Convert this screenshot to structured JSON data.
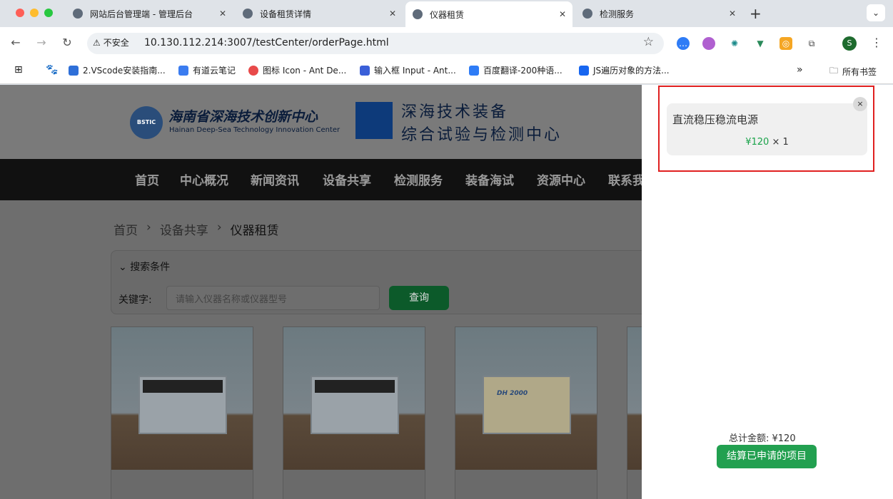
{
  "browser": {
    "tabs": [
      {
        "title": "网站后台管理端 - 管理后台",
        "active": false
      },
      {
        "title": "设备租赁详情",
        "active": false
      },
      {
        "title": "仪器租赁",
        "active": true
      },
      {
        "title": "检测服务",
        "active": false
      }
    ],
    "new_tab": "+",
    "security_label": "不安全",
    "url": "10.130.112.214:3007/testCenter/orderPage.html",
    "profile_initial": "S",
    "bookmarks": [
      "2.VScode安装指南...",
      "有道云笔记",
      "图标 Icon - Ant De...",
      "输入框 Input - Ant...",
      "百度翻译-200种语...",
      "JS遍历对象的方法..."
    ],
    "bookmarks_more": "»",
    "all_bookmarks": "所有书签"
  },
  "site": {
    "logo_text": "BSTIC",
    "org_name_cn": "海南省深海技术创新中心",
    "org_name_en": "Hainan Deep-Sea Technology Innovation Center",
    "center_line1": "深海技术装备",
    "center_line2": "综合试验与检测中心",
    "nav": [
      "首页",
      "中心概况",
      "新闻资讯",
      "设备共享",
      "检测服务",
      "装备海试",
      "资源中心",
      "联系我"
    ],
    "breadcrumb": [
      "首页",
      "设备共享",
      "仪器租赁"
    ],
    "breadcrumb_sep": "›",
    "search_header": "搜索条件",
    "keyword_label": "关键字:",
    "keyword_placeholder": "请输入仪器名称或仪器型号",
    "query_button": "查询",
    "card3_model": "DH 2000"
  },
  "cart": {
    "close": "×",
    "item_name": "直流稳压稳流电源",
    "item_price": "¥120",
    "item_qty": "× 1",
    "total_label": "总计金额: ¥120",
    "submit_label": "结算已申请的项目"
  }
}
